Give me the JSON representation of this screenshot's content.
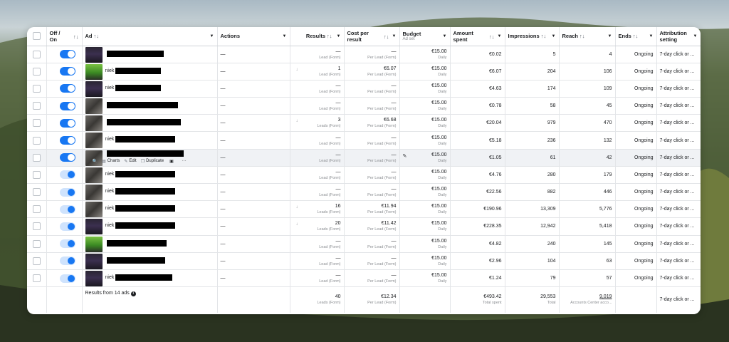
{
  "columns": {
    "off_on": "Off / On",
    "ad": "Ad",
    "actions": "Actions",
    "results": "Results",
    "cost_per_result": "Cost per result",
    "budget": "Budget",
    "budget_sub": "Ad set",
    "amount_spent": "Amount spent",
    "impressions": "Impressions",
    "reach": "Reach",
    "ends": "Ends",
    "attribution": "Attribution setting"
  },
  "sort_glyph": "↑↓",
  "caret_glyph": "▼",
  "rows": [
    {
      "name": "",
      "thumb": "dark",
      "toggle": "on",
      "dash": "—",
      "results": "—",
      "results_sub": "Lead (Form)",
      "result_icon": "",
      "cpr": "—",
      "cpr_sub": "Per Lead (Form)",
      "budget": "€15.00",
      "budget_sub": "Daily",
      "spent": "€0.02",
      "impressions": "5",
      "reach": "4",
      "ends": "Ongoing",
      "attribution": "7-day click or ..."
    },
    {
      "name": "niek",
      "thumb": "green",
      "toggle": "on",
      "dash": "—",
      "results": "1",
      "results_sub": "Lead (Form)",
      "result_icon": "↓",
      "cpr": "€6.07",
      "cpr_sub": "Per Lead (Form)",
      "budget": "€15.00",
      "budget_sub": "Daily",
      "spent": "€6.07",
      "impressions": "204",
      "reach": "106",
      "ends": "Ongoing",
      "attribution": "7-day click or ..."
    },
    {
      "name": "niek",
      "thumb": "dark",
      "toggle": "on",
      "dash": "—",
      "results": "—",
      "results_sub": "Lead (Form)",
      "result_icon": "",
      "cpr": "—",
      "cpr_sub": "Per Lead (Form)",
      "budget": "€15.00",
      "budget_sub": "Daily",
      "spent": "€4.63",
      "impressions": "174",
      "reach": "109",
      "ends": "Ongoing",
      "attribution": "7-day click or ..."
    },
    {
      "name": "",
      "thumb": "photo",
      "toggle": "on",
      "dash": "—",
      "results": "—",
      "results_sub": "Lead (Form)",
      "result_icon": "",
      "cpr": "—",
      "cpr_sub": "Per Lead (Form)",
      "budget": "€15.00",
      "budget_sub": "Daily",
      "spent": "€0.78",
      "impressions": "58",
      "reach": "45",
      "ends": "Ongoing",
      "attribution": "7-day click or ..."
    },
    {
      "name": "",
      "thumb": "photo",
      "toggle": "on",
      "dash": "—",
      "results": "3",
      "results_sub": "Leads (Form)",
      "result_icon": "↓",
      "cpr": "€6.68",
      "cpr_sub": "Per Lead (Form)",
      "budget": "€15.00",
      "budget_sub": "Daily",
      "spent": "€20.04",
      "impressions": "979",
      "reach": "470",
      "ends": "Ongoing",
      "attribution": "7-day click or ..."
    },
    {
      "name": "niek",
      "thumb": "photo",
      "toggle": "on",
      "dash": "—",
      "results": "—",
      "results_sub": "Lead (Form)",
      "result_icon": "",
      "cpr": "—",
      "cpr_sub": "Per Lead (Form)",
      "budget": "€15.00",
      "budget_sub": "Daily",
      "spent": "€5.18",
      "impressions": "236",
      "reach": "132",
      "ends": "Ongoing",
      "attribution": "7-day click or ..."
    },
    {
      "name": "",
      "thumb": "photo",
      "toggle": "on",
      "dash": "—",
      "results": "—",
      "results_sub": "Lead (Form)",
      "result_icon": "",
      "cpr": "—",
      "cpr_sub": "Per Lead (Form)",
      "budget": "€15.00",
      "budget_sub": "Daily",
      "spent": "€1.05",
      "impressions": "61",
      "reach": "42",
      "ends": "Ongoing",
      "attribution": "7-day click or ...",
      "highlight": true
    },
    {
      "name": "niek",
      "thumb": "photo",
      "toggle": "light",
      "dash": "—",
      "results": "—",
      "results_sub": "Lead (Form)",
      "result_icon": "",
      "cpr": "—",
      "cpr_sub": "Per Lead (Form)",
      "budget": "€15.00",
      "budget_sub": "Daily",
      "spent": "€4.76",
      "impressions": "280",
      "reach": "179",
      "ends": "Ongoing",
      "attribution": "7-day click or ..."
    },
    {
      "name": "niek",
      "thumb": "photo",
      "toggle": "light",
      "dash": "—",
      "results": "—",
      "results_sub": "Lead (Form)",
      "result_icon": "",
      "cpr": "—",
      "cpr_sub": "Per Lead (Form)",
      "budget": "€15.00",
      "budget_sub": "Daily",
      "spent": "€22.56",
      "impressions": "882",
      "reach": "446",
      "ends": "Ongoing",
      "attribution": "7-day click or ..."
    },
    {
      "name": "niek",
      "thumb": "photo",
      "toggle": "light",
      "dash": "—",
      "results": "16",
      "results_sub": "Leads (Form)",
      "result_icon": "↓",
      "cpr": "€11.94",
      "cpr_sub": "Per Lead (Form)",
      "budget": "€15.00",
      "budget_sub": "Daily",
      "spent": "€190.96",
      "impressions": "13,309",
      "reach": "5,776",
      "ends": "Ongoing",
      "attribution": "7-day click or ..."
    },
    {
      "name": "niek",
      "thumb": "dark",
      "toggle": "light",
      "dash": "—",
      "results": "20",
      "results_sub": "Leads (Form)",
      "result_icon": "↓",
      "cpr": "€11.42",
      "cpr_sub": "Per Lead (Form)",
      "budget": "€15.00",
      "budget_sub": "Daily",
      "spent": "€228.35",
      "impressions": "12,942",
      "reach": "5,418",
      "ends": "Ongoing",
      "attribution": "7-day click or ..."
    },
    {
      "name": "",
      "thumb": "green",
      "toggle": "light",
      "dash": "—",
      "results": "—",
      "results_sub": "Lead (Form)",
      "result_icon": "",
      "cpr": "—",
      "cpr_sub": "Per Lead (Form)",
      "budget": "€15.00",
      "budget_sub": "Daily",
      "spent": "€4.82",
      "impressions": "240",
      "reach": "145",
      "ends": "Ongoing",
      "attribution": "7-day click or ..."
    },
    {
      "name": "",
      "thumb": "dark",
      "toggle": "light",
      "dash": "—",
      "results": "—",
      "results_sub": "Lead (Form)",
      "result_icon": "",
      "cpr": "—",
      "cpr_sub": "Per Lead (Form)",
      "budget": "€15.00",
      "budget_sub": "Daily",
      "spent": "€2.96",
      "impressions": "104",
      "reach": "63",
      "ends": "Ongoing",
      "attribution": "7-day click or ..."
    },
    {
      "name": "niek",
      "thumb": "dark",
      "toggle": "light",
      "dash": "—",
      "results": "—",
      "results_sub": "Lead (Form)",
      "result_icon": "",
      "cpr": "—",
      "cpr_sub": "Per Lead (Form)",
      "budget": "€15.00",
      "budget_sub": "Daily",
      "spent": "€1.24",
      "impressions": "79",
      "reach": "57",
      "ends": "Ongoing",
      "attribution": "7-day click or ..."
    }
  ],
  "hover_actions": {
    "charts": "Charts",
    "edit": "Edit",
    "duplicate": "Duplicate",
    "more": "···"
  },
  "footer": {
    "label": "Results from 14 ads",
    "info_glyph": "i",
    "results": "40",
    "results_sub": "Leads (Form)",
    "cpr": "€12.34",
    "cpr_sub": "Per Lead (Form)",
    "spent": "€493.42",
    "spent_sub": "Total spent",
    "impressions": "29,553",
    "impressions_sub": "Total",
    "reach": "9,019",
    "reach_sub": "Accounts Center acco...",
    "attribution": "7-day click or ..."
  },
  "colors": {
    "toggle_on": "#1877f2",
    "toggle_light": "#cfe3fd"
  }
}
